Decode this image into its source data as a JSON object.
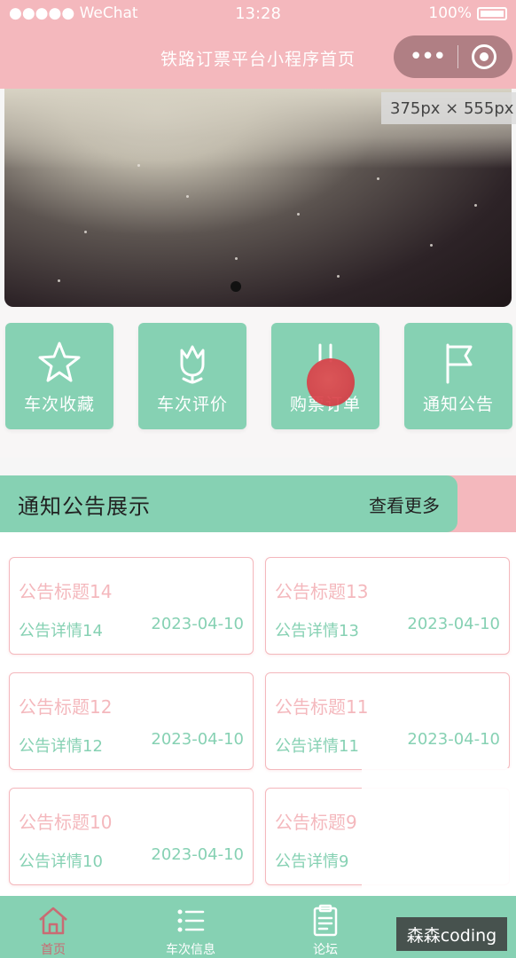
{
  "status_bar": {
    "carrier": "●●●●● WeChat",
    "time": "13:28",
    "battery": "100%"
  },
  "nav": {
    "title": "铁路订票平台小程序首页"
  },
  "banner": {
    "size_badge": "375px × 555px"
  },
  "menu": {
    "items": [
      {
        "label": "车次收藏",
        "icon": "star-icon"
      },
      {
        "label": "车次评价",
        "icon": "tulip-icon"
      },
      {
        "label": "购票订单",
        "icon": "ticket-icon"
      },
      {
        "label": "通知公告",
        "icon": "flag-icon"
      }
    ]
  },
  "notice": {
    "title": "通知公告展示",
    "more": "查看更多",
    "cards": [
      {
        "title": "公告标题14",
        "detail": "公告详情14",
        "date": "2023-04-10"
      },
      {
        "title": "公告标题13",
        "detail": "公告详情13",
        "date": "2023-04-10"
      },
      {
        "title": "公告标题12",
        "detail": "公告详情12",
        "date": "2023-04-10"
      },
      {
        "title": "公告标题11",
        "detail": "公告详情11",
        "date": "2023-04-10"
      },
      {
        "title": "公告标题10",
        "detail": "公告详情10",
        "date": "2023-04-10"
      },
      {
        "title": "公告标题9",
        "detail": "公告详情9",
        "date": ""
      }
    ]
  },
  "tabbar": {
    "items": [
      {
        "label": "首页",
        "icon": "home-icon"
      },
      {
        "label": "车次信息",
        "icon": "list-icon"
      },
      {
        "label": "论坛",
        "icon": "clipboard-icon"
      }
    ]
  },
  "watermark": "森森coding",
  "colors": {
    "pink": "#f4b8bd",
    "green": "#86d1b3",
    "active_tab": "#c96b73"
  }
}
